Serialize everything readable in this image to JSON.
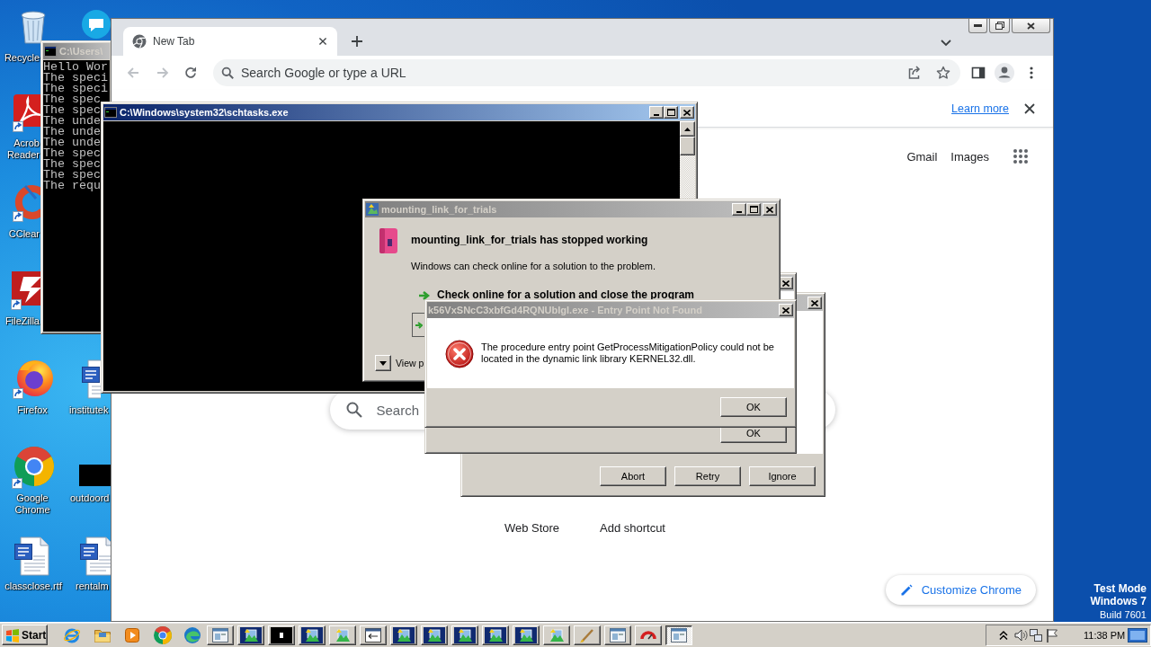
{
  "desktop": {
    "icons": [
      {
        "kind": "recycle-bin",
        "label": "Recycle"
      },
      {
        "kind": "pdf-reader",
        "label": "Acrob Reader"
      },
      {
        "kind": "cleaner",
        "label": "CClear"
      },
      {
        "kind": "ftp-client",
        "label": "FileZilla"
      },
      {
        "kind": "firefox",
        "label": "Firefox"
      },
      {
        "kind": "chrome",
        "label": "Google Chrome"
      },
      {
        "kind": "document",
        "label": "classclose.rtf"
      },
      {
        "kind": "skype"
      },
      {
        "kind": "document",
        "label": "institutek"
      },
      {
        "kind": "thumbnail",
        "label": "outdoord"
      },
      {
        "kind": "document",
        "label": "rentalm"
      }
    ],
    "test_mode_notice": [
      "Test Mode",
      "Windows 7",
      "Build 7601"
    ]
  },
  "windows": [
    {
      "kind": "console",
      "title": "C:\\Users\\",
      "active": false,
      "scrollbar": false,
      "lines": [
        "Hello Wor",
        "The speci",
        "The speci",
        "The spec",
        "The spec",
        "The unde",
        "The unde",
        "The unde",
        "The spec",
        "The spec",
        "The spec",
        "The requ"
      ]
    },
    {
      "kind": "browser",
      "tabs": [
        {
          "title": "New Tab",
          "selected": true
        }
      ],
      "omnibox": {
        "placeholder": "Search Google or type a URL"
      },
      "infobar": {
        "link": "Learn more"
      },
      "header_links": [
        "Gmail",
        "Images"
      ],
      "search": {
        "placeholder": "Search"
      },
      "shortcuts": [
        {
          "label": "Web Store"
        },
        {
          "label": "Add shortcut"
        }
      ],
      "customize_button": "Customize Chrome"
    },
    {
      "kind": "console",
      "title": "C:\\Windows\\system32\\schtasks.exe",
      "active": true,
      "scrollbar": true
    },
    {
      "kind": "message_box",
      "active": false,
      "buttons": [
        {
          "label": "Abort"
        },
        {
          "label": "Retry"
        },
        {
          "label": "Ignore"
        }
      ]
    },
    {
      "kind": "message_box",
      "active": false,
      "buttons": [
        {
          "label": "OK"
        }
      ]
    },
    {
      "kind": "error_report",
      "title": "mounting_link_for_trials",
      "active": false,
      "heading": "mounting_link_for_trials has stopped working",
      "text": "Windows can check online for a solution to the problem.",
      "options": [
        "Check online for a solution and close the program"
      ],
      "details_toggle": "View p"
    },
    {
      "kind": "error_box",
      "title": "k56VxSNcC3xbfGd4RQNUbIgl.exe - Entry Point Not Found",
      "active": false,
      "message": "The procedure entry point GetProcessMitigationPolicy could not be located in the dynamic link library KERNEL32.dll.",
      "buttons": [
        {
          "label": "OK"
        }
      ]
    }
  ],
  "taskbar": {
    "start": "Start",
    "quick_launch": [
      {
        "kind": "ie"
      },
      {
        "kind": "folder"
      },
      {
        "kind": "media"
      },
      {
        "kind": "chrome"
      },
      {
        "kind": "edge"
      }
    ],
    "tasks": [
      {
        "kind": "window",
        "selected": false
      },
      {
        "kind": "program",
        "selected": false
      },
      {
        "kind": "console",
        "selected": false
      },
      {
        "kind": "program",
        "selected": false
      },
      {
        "kind": "app",
        "selected": false
      },
      {
        "kind": "dialog",
        "selected": false
      },
      {
        "kind": "program",
        "selected": false
      },
      {
        "kind": "program",
        "selected": false
      },
      {
        "kind": "program",
        "selected": false
      },
      {
        "kind": "program",
        "selected": false
      },
      {
        "kind": "program",
        "selected": false
      },
      {
        "kind": "app",
        "selected": false
      },
      {
        "kind": "brush",
        "selected": false
      },
      {
        "kind": "window",
        "selected": false
      },
      {
        "kind": "gauge",
        "selected": false
      },
      {
        "kind": "window",
        "selected": true
      }
    ],
    "tray": {
      "icons": [
        {
          "kind": "chevron"
        },
        {
          "kind": "speaker"
        },
        {
          "kind": "network"
        },
        {
          "kind": "flag"
        }
      ],
      "clock": "11:38 PM"
    }
  }
}
